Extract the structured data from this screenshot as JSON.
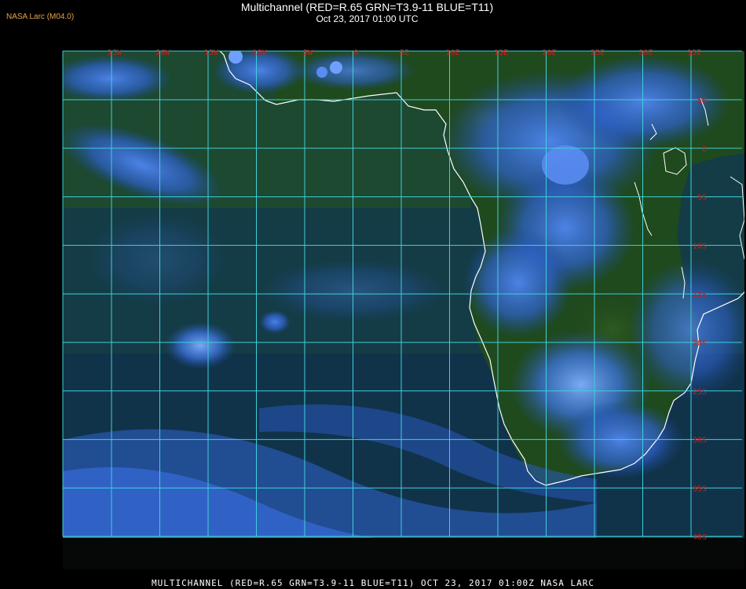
{
  "header": {
    "badge": "NASA Larc (M04.0)",
    "title": "Multichannel (RED=R.65 GRN=T3.9-11 BLUE=T11)",
    "subtitle": "Oct 23, 2017 01:00 UTC"
  },
  "footer": {
    "caption": "MULTICHANNEL (RED=R.65 GRN=T3.9-11 BLUE=T11) OCT 23, 2017 01:00Z   NASA LARC"
  },
  "map": {
    "longitude_labels": [
      "25W",
      "20W",
      "15W",
      "10W",
      "5W",
      "0",
      "5E",
      "10E",
      "15E",
      "20E",
      "25E",
      "30E",
      "35E"
    ],
    "latitude_labels": [
      "5N",
      "0",
      "5S",
      "10S",
      "15S",
      "20S",
      "25S",
      "30S",
      "35S",
      "40S"
    ],
    "colors": {
      "grid": "#3fd0d8",
      "coast": "#ffffff",
      "tick_label": "#c81e1e",
      "ocean": "#123a4a",
      "land": "#1f4a1e",
      "cloud": "#2f68d8"
    }
  }
}
